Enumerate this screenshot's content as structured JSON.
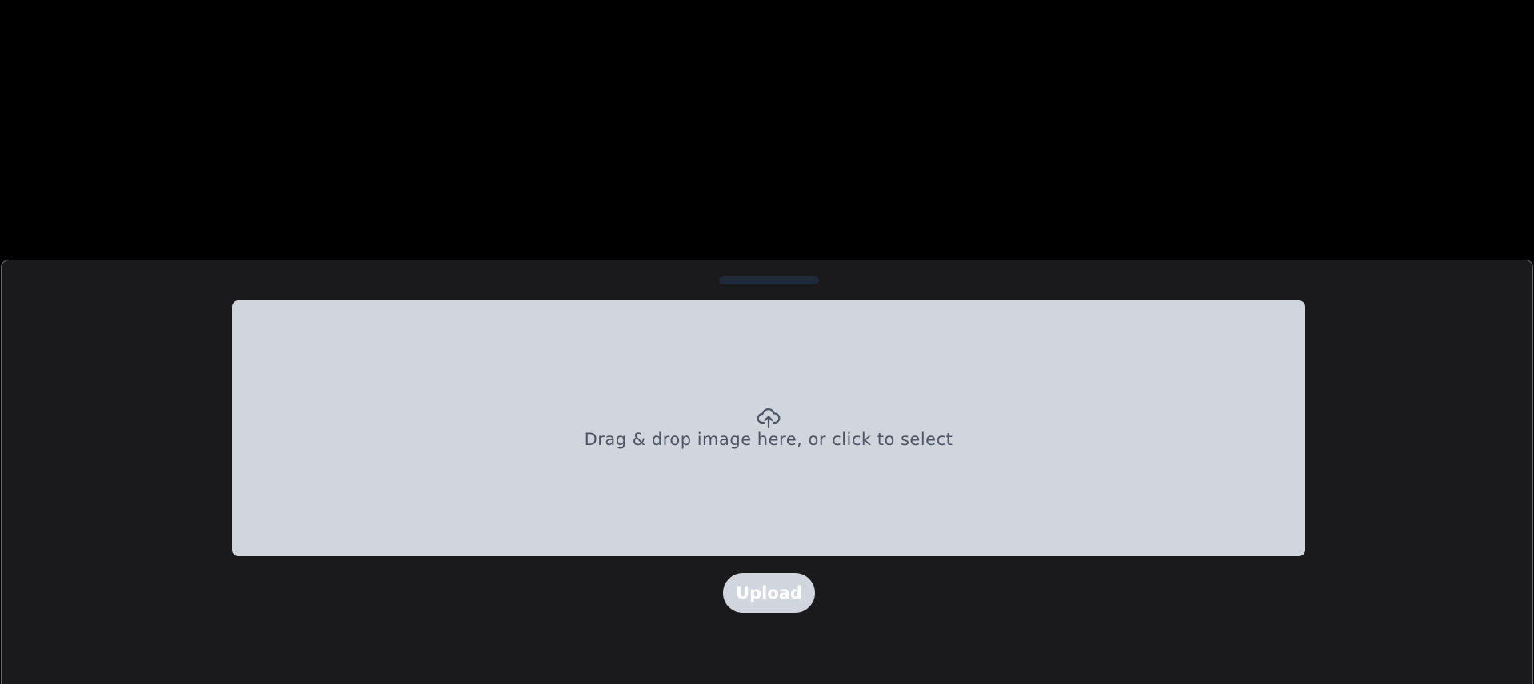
{
  "dropzone": {
    "icon": "cloud-upload-icon",
    "text": "Drag & drop image here, or click to select"
  },
  "upload_button": {
    "label": "Upload",
    "disabled": true
  },
  "colors": {
    "page_background": "#000000",
    "sheet_background": "#1a1a1c",
    "dropzone_background": "#d1d5de",
    "dropzone_text": "#4d5564",
    "handle": "#1e2a3c",
    "button_text": "#ffffff"
  }
}
